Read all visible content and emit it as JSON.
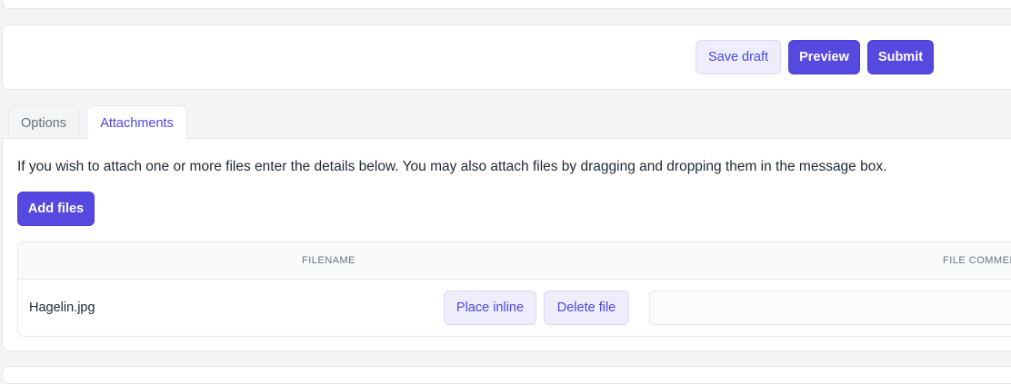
{
  "actions": {
    "save_draft": "Save draft",
    "preview": "Preview",
    "submit": "Submit"
  },
  "tabs": [
    {
      "label": "Options",
      "active": false
    },
    {
      "label": "Attachments",
      "active": true
    }
  ],
  "attachments": {
    "intro": "If you wish to attach one or more files enter the details below. You may also attach files by dragging and dropping them in the message box.",
    "add_files": "Add files",
    "columns": {
      "filename": "FILENAME",
      "comment": "FILE COMMENT"
    },
    "files": [
      {
        "name": "Hagelin.jpg",
        "place_inline": "Place inline",
        "delete": "Delete file",
        "comment": ""
      }
    ]
  },
  "colors": {
    "accent": "#5649e0",
    "accent_light": "#eeedfb",
    "border": "#e5e7eb",
    "background": "#f3f4f6"
  }
}
